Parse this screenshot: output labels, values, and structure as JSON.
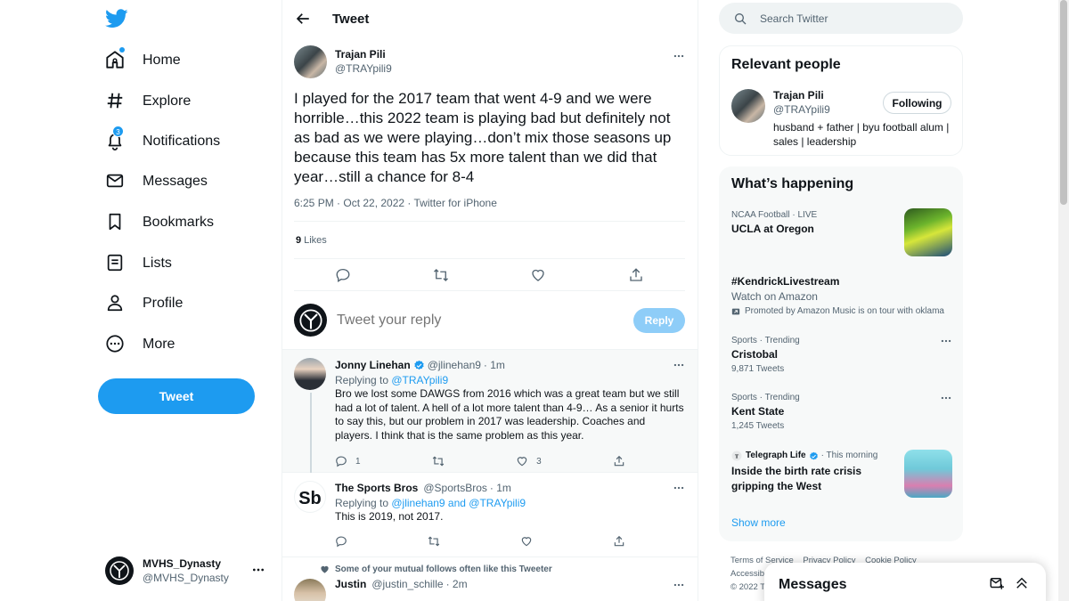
{
  "nav": {
    "items": [
      {
        "label": "Home"
      },
      {
        "label": "Explore"
      },
      {
        "label": "Notifications",
        "badge": "3"
      },
      {
        "label": "Messages"
      },
      {
        "label": "Bookmarks"
      },
      {
        "label": "Lists"
      },
      {
        "label": "Profile"
      },
      {
        "label": "More"
      }
    ],
    "tweet_button": "Tweet",
    "account": {
      "name": "MVHS_Dynasty",
      "handle": "@MVHS_Dynasty"
    }
  },
  "header": {
    "title": "Tweet"
  },
  "focal_tweet": {
    "author_name": "Trajan Pili",
    "author_handle": "@TRAYpili9",
    "text": "I played for the 2017 team that went 4-9 and we were horrible…this 2022 team is playing bad but definitely not as bad as we were playing…don’t mix those seasons up because this team has 5x more talent than we did that year…still a chance for 8-4",
    "meta": "6:25 PM · Oct 22, 2022 · Twitter for iPhone",
    "likes_count": "9",
    "likes_label": "Likes"
  },
  "reply_box": {
    "placeholder": "Tweet your reply",
    "button": "Reply"
  },
  "replies": [
    {
      "name": "Jonny Linehan",
      "handle": "@jlinehan9",
      "time": "· 1m",
      "replying_prefix": "Replying to ",
      "replying_to": "@TRAYpili9",
      "text": "Bro we lost some DAWGS from 2016 which was a great team but we still had a lot of talent. A hell of a lot more talent than 4-9… As a senior it hurts to say this, but our problem in 2017 was leadership. Coaches and players. I think that is the same problem as this year.",
      "reply_count": "1",
      "like_count": "3"
    },
    {
      "name": "The Sports Bros",
      "handle": "@SportsBros",
      "time": "· 1m",
      "replying_prefix": "Replying to ",
      "replying_to": "@jlinehan9 and @TRAYpili9",
      "text": "This is 2019, not 2017."
    },
    {
      "mutual_note": "Some of your mutual follows often like this Tweeter",
      "name": "Justin",
      "handle": "@justin_schille",
      "time": "· 2m"
    }
  ],
  "search": {
    "placeholder": "Search Twitter"
  },
  "relevant_people": {
    "title": "Relevant people",
    "name": "Trajan Pili",
    "handle": "@TRAYpili9",
    "bio": "husband + father | byu football alum | sales | leadership",
    "follow_button": "Following"
  },
  "happening": {
    "title": "What’s happening",
    "trends": [
      {
        "context": "NCAA Football · LIVE",
        "name": "UCLA at Oregon"
      },
      {
        "name": "#KendrickLivestream",
        "sub": "Watch on Amazon",
        "promoted": "Promoted by Amazon Music is on tour with oklama"
      },
      {
        "context": "Sports · Trending",
        "name": "Cristobal",
        "sub": "9,871 Tweets"
      },
      {
        "context": "Sports · Trending",
        "name": "Kent State",
        "sub": "1,245 Tweets"
      },
      {
        "source": "Telegraph Life",
        "time": "· This morning",
        "name": "Inside the birth rate crisis gripping the West"
      }
    ],
    "show_more": "Show more"
  },
  "footer": {
    "links": [
      "Terms of Service",
      "Privacy Policy",
      "Cookie Policy"
    ],
    "line2": "Accessib",
    "line3": "© 2022 T"
  },
  "messages_drawer": {
    "title": "Messages"
  },
  "colors": {
    "accent": "#1d9bf0",
    "text": "#0f1419",
    "secondary": "#536471"
  }
}
